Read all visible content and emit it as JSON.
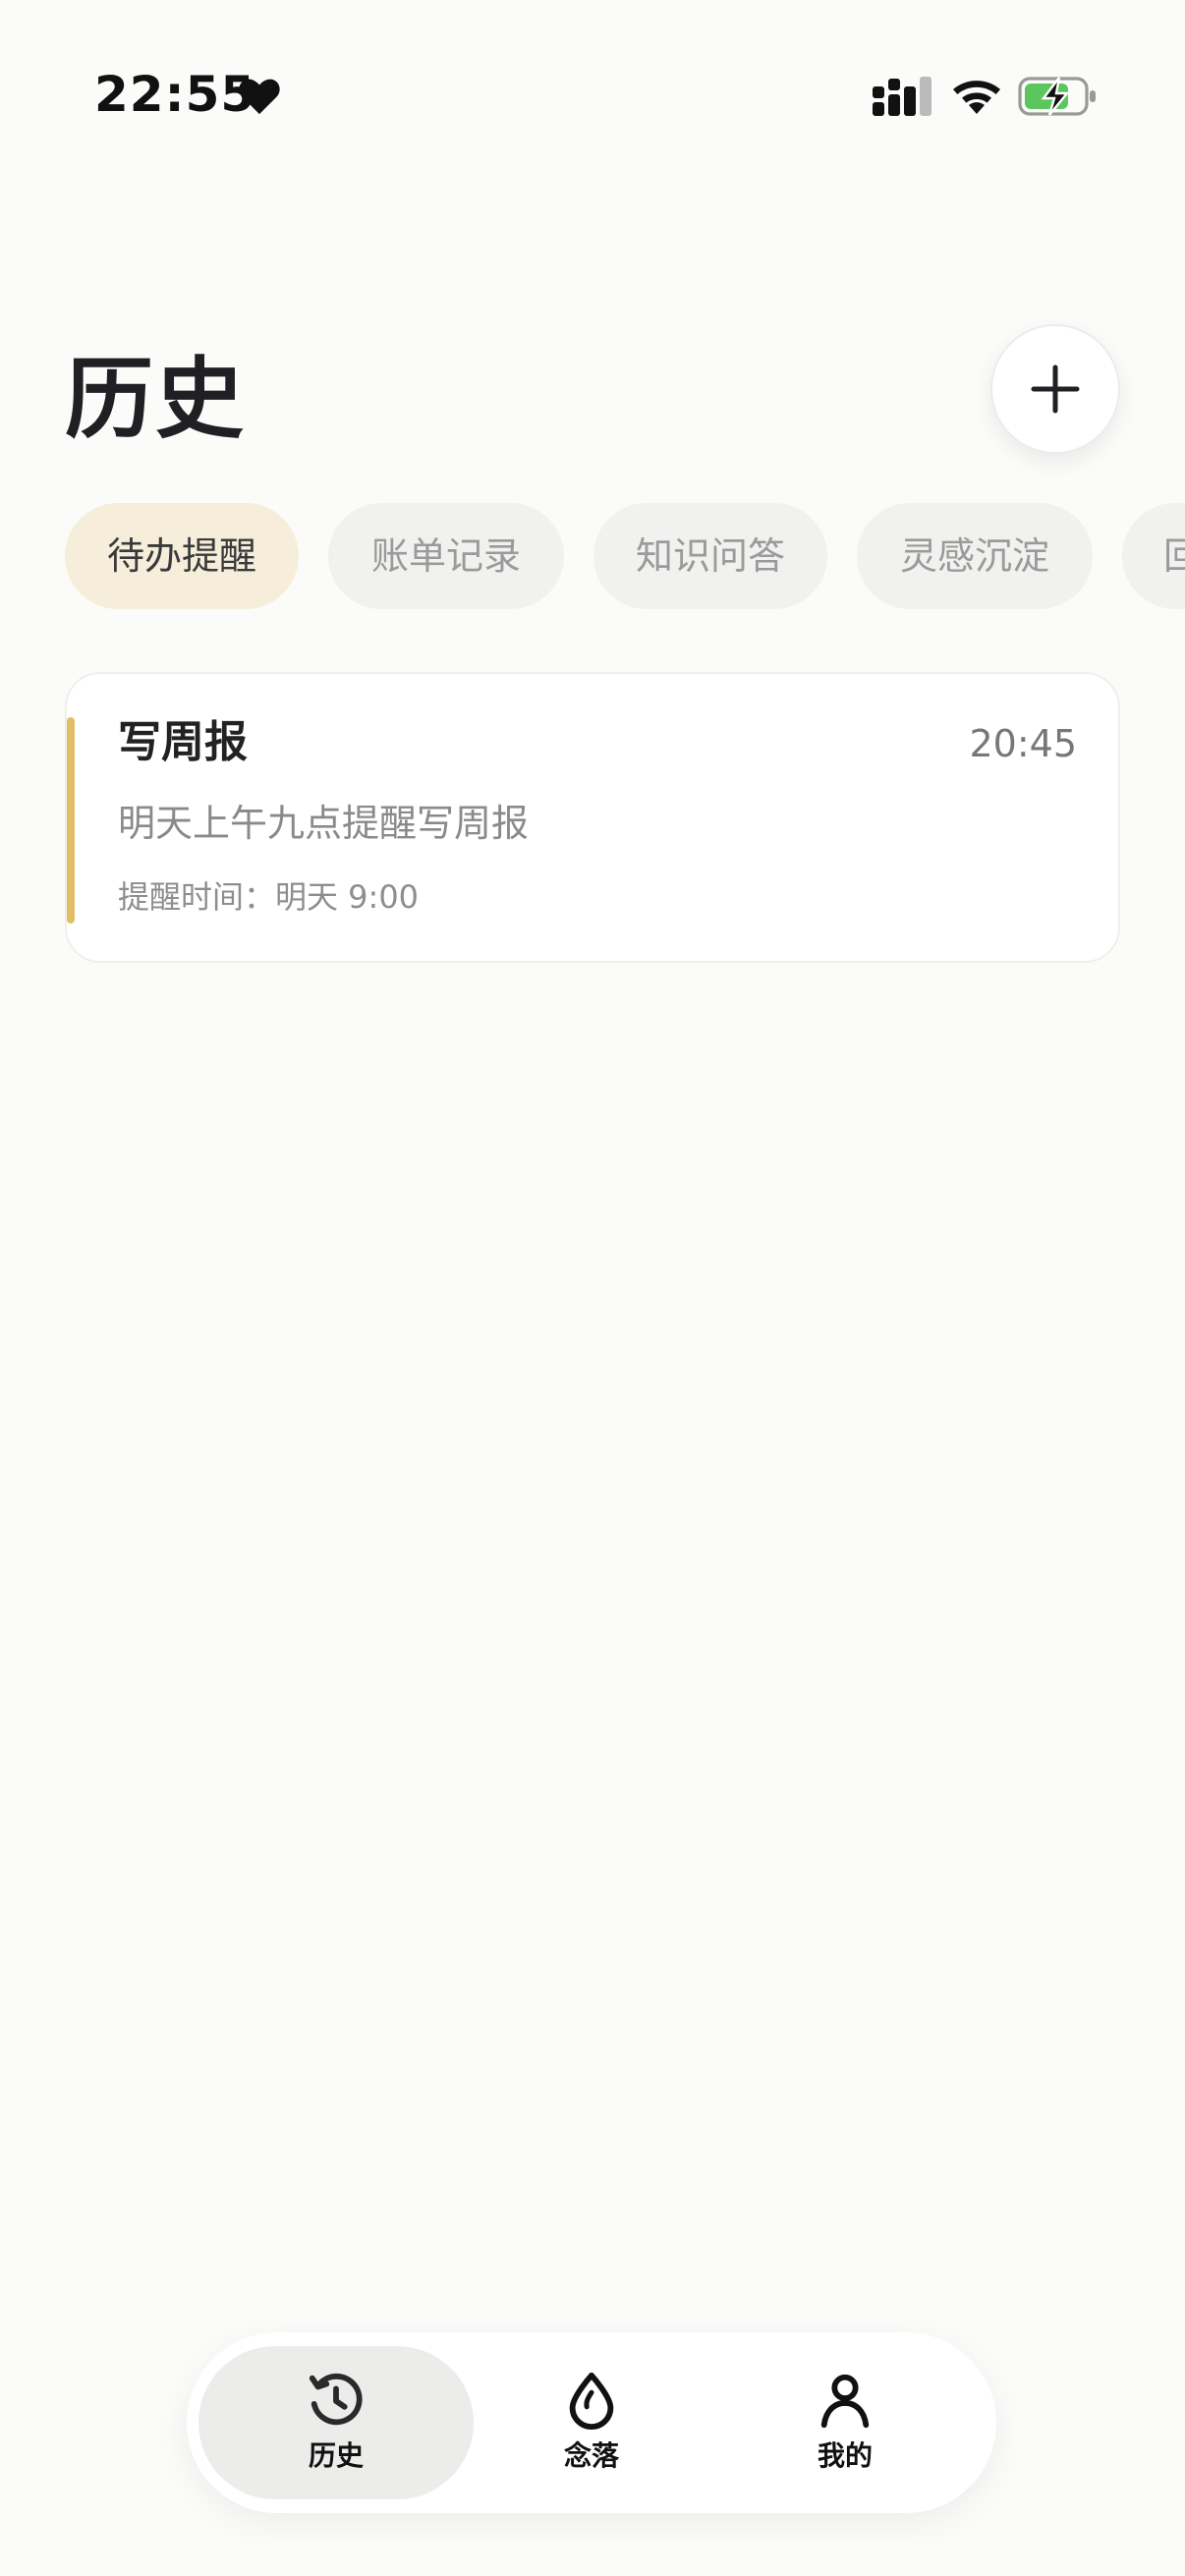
{
  "status_bar": {
    "time": "22:55",
    "icons": [
      "heart-icon",
      "cellular-signal-icon",
      "wifi-icon",
      "battery-charging-icon"
    ]
  },
  "header": {
    "title": "历史",
    "add_icon": "plus-icon"
  },
  "filters": {
    "chips": [
      {
        "label": "待办提醒",
        "active": true
      },
      {
        "label": "账单记录",
        "active": false
      },
      {
        "label": "知识问答",
        "active": false
      },
      {
        "label": "灵感沉淀",
        "active": false
      },
      {
        "label": "回",
        "active": false
      }
    ]
  },
  "entries": [
    {
      "title": "写周报",
      "time": "20:45",
      "content": "明天上午九点提醒写周报",
      "reminder": "提醒时间：明天 9:00"
    }
  ],
  "bottom_nav": {
    "items": [
      {
        "label": "历史",
        "icon": "history-icon",
        "active": true
      },
      {
        "label": "念落",
        "icon": "droplet-icon",
        "active": false
      },
      {
        "label": "我的",
        "icon": "person-icon",
        "active": false
      }
    ]
  },
  "colors": {
    "background": "#fbfbf9",
    "accent": "#e2bf67",
    "active_chip_bg": "#f6eedb",
    "inactive_chip_bg": "#f1f1ef",
    "battery_green": "#5cc65e"
  }
}
